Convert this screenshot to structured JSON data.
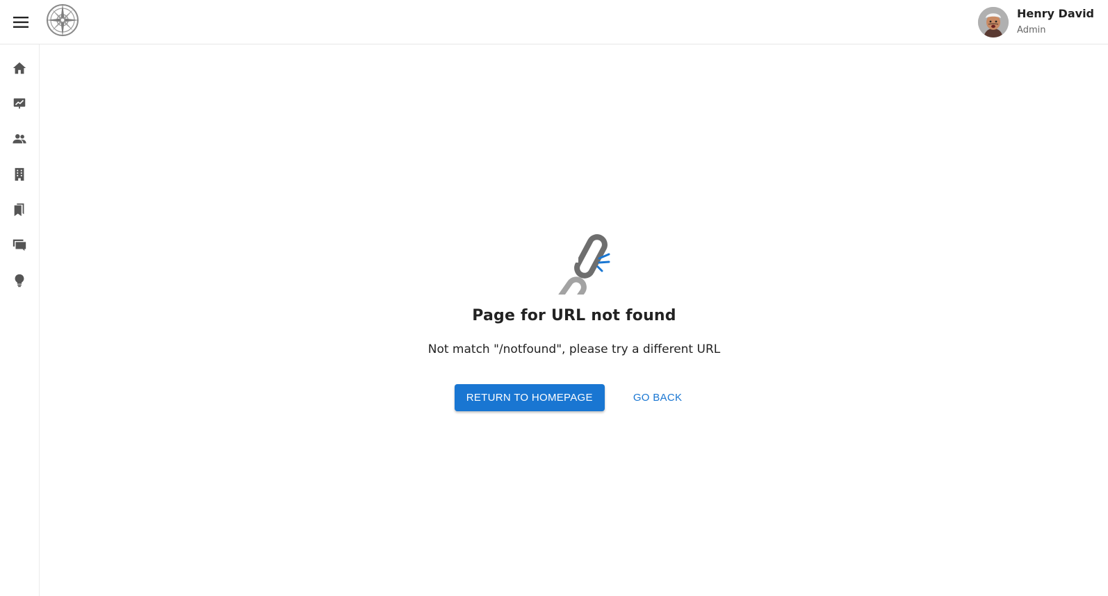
{
  "header": {
    "menu_icon": "menu-icon",
    "logo_icon": "compass-logo-icon",
    "user": {
      "name": "Henry David",
      "role": "Admin",
      "avatar_icon": "user-avatar"
    }
  },
  "sidebar": {
    "items": [
      {
        "icon": "home-icon"
      },
      {
        "icon": "chart-presentation-icon"
      },
      {
        "icon": "people-icon"
      },
      {
        "icon": "building-icon"
      },
      {
        "icon": "bookmarks-icon"
      },
      {
        "icon": "chat-forum-icon"
      },
      {
        "icon": "lightbulb-icon"
      }
    ]
  },
  "not_found": {
    "illustration_icon": "broken-link-icon",
    "title": "Page for URL not found",
    "message": "Not match \"/notfound\", please try a different URL",
    "primary_button": "RETURN TO HOMEPAGE",
    "secondary_button": "GO BACK"
  },
  "colors": {
    "primary": "#1976d2",
    "icon_gray": "#555555",
    "text": "#222222"
  }
}
